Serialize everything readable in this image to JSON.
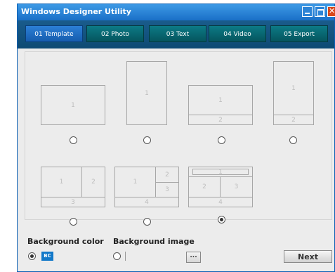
{
  "window": {
    "title": "Windows Designer Utility"
  },
  "tabs": [
    {
      "label": "01 Template",
      "active": true
    },
    {
      "label": "02 Photo",
      "active": false
    },
    {
      "label": "03 Text",
      "active": false
    },
    {
      "label": "04 Video",
      "active": false
    },
    {
      "label": "05 Export",
      "active": false
    }
  ],
  "layouts": [
    {
      "cells": [
        "1"
      ],
      "selected": false
    },
    {
      "cells": [
        "1"
      ],
      "selected": false
    },
    {
      "cells": [
        "1",
        "2"
      ],
      "selected": false
    },
    {
      "cells": [
        "1",
        "2"
      ],
      "selected": false
    },
    {
      "cells": [
        "1",
        "2",
        "3"
      ],
      "selected": false
    },
    {
      "cells": [
        "1",
        "2",
        "3",
        "4"
      ],
      "selected": false
    },
    {
      "cells": [
        "1",
        "2",
        "3",
        "4"
      ],
      "selected": true
    }
  ],
  "background": {
    "color_label": "Background color",
    "color_swatch": "BC",
    "color_value": "#1279c9",
    "color_selected": true,
    "image_label": "Background image",
    "image_selected": false,
    "browse_label": "...",
    "browse_icon": "ellipsis-icon"
  },
  "footer": {
    "next_label": "Next"
  },
  "colors": {
    "accent": "#1a6fc7",
    "tab_active": "#2c7fd6",
    "tab_inactive": "#0c7a86",
    "close": "#d9481c"
  }
}
